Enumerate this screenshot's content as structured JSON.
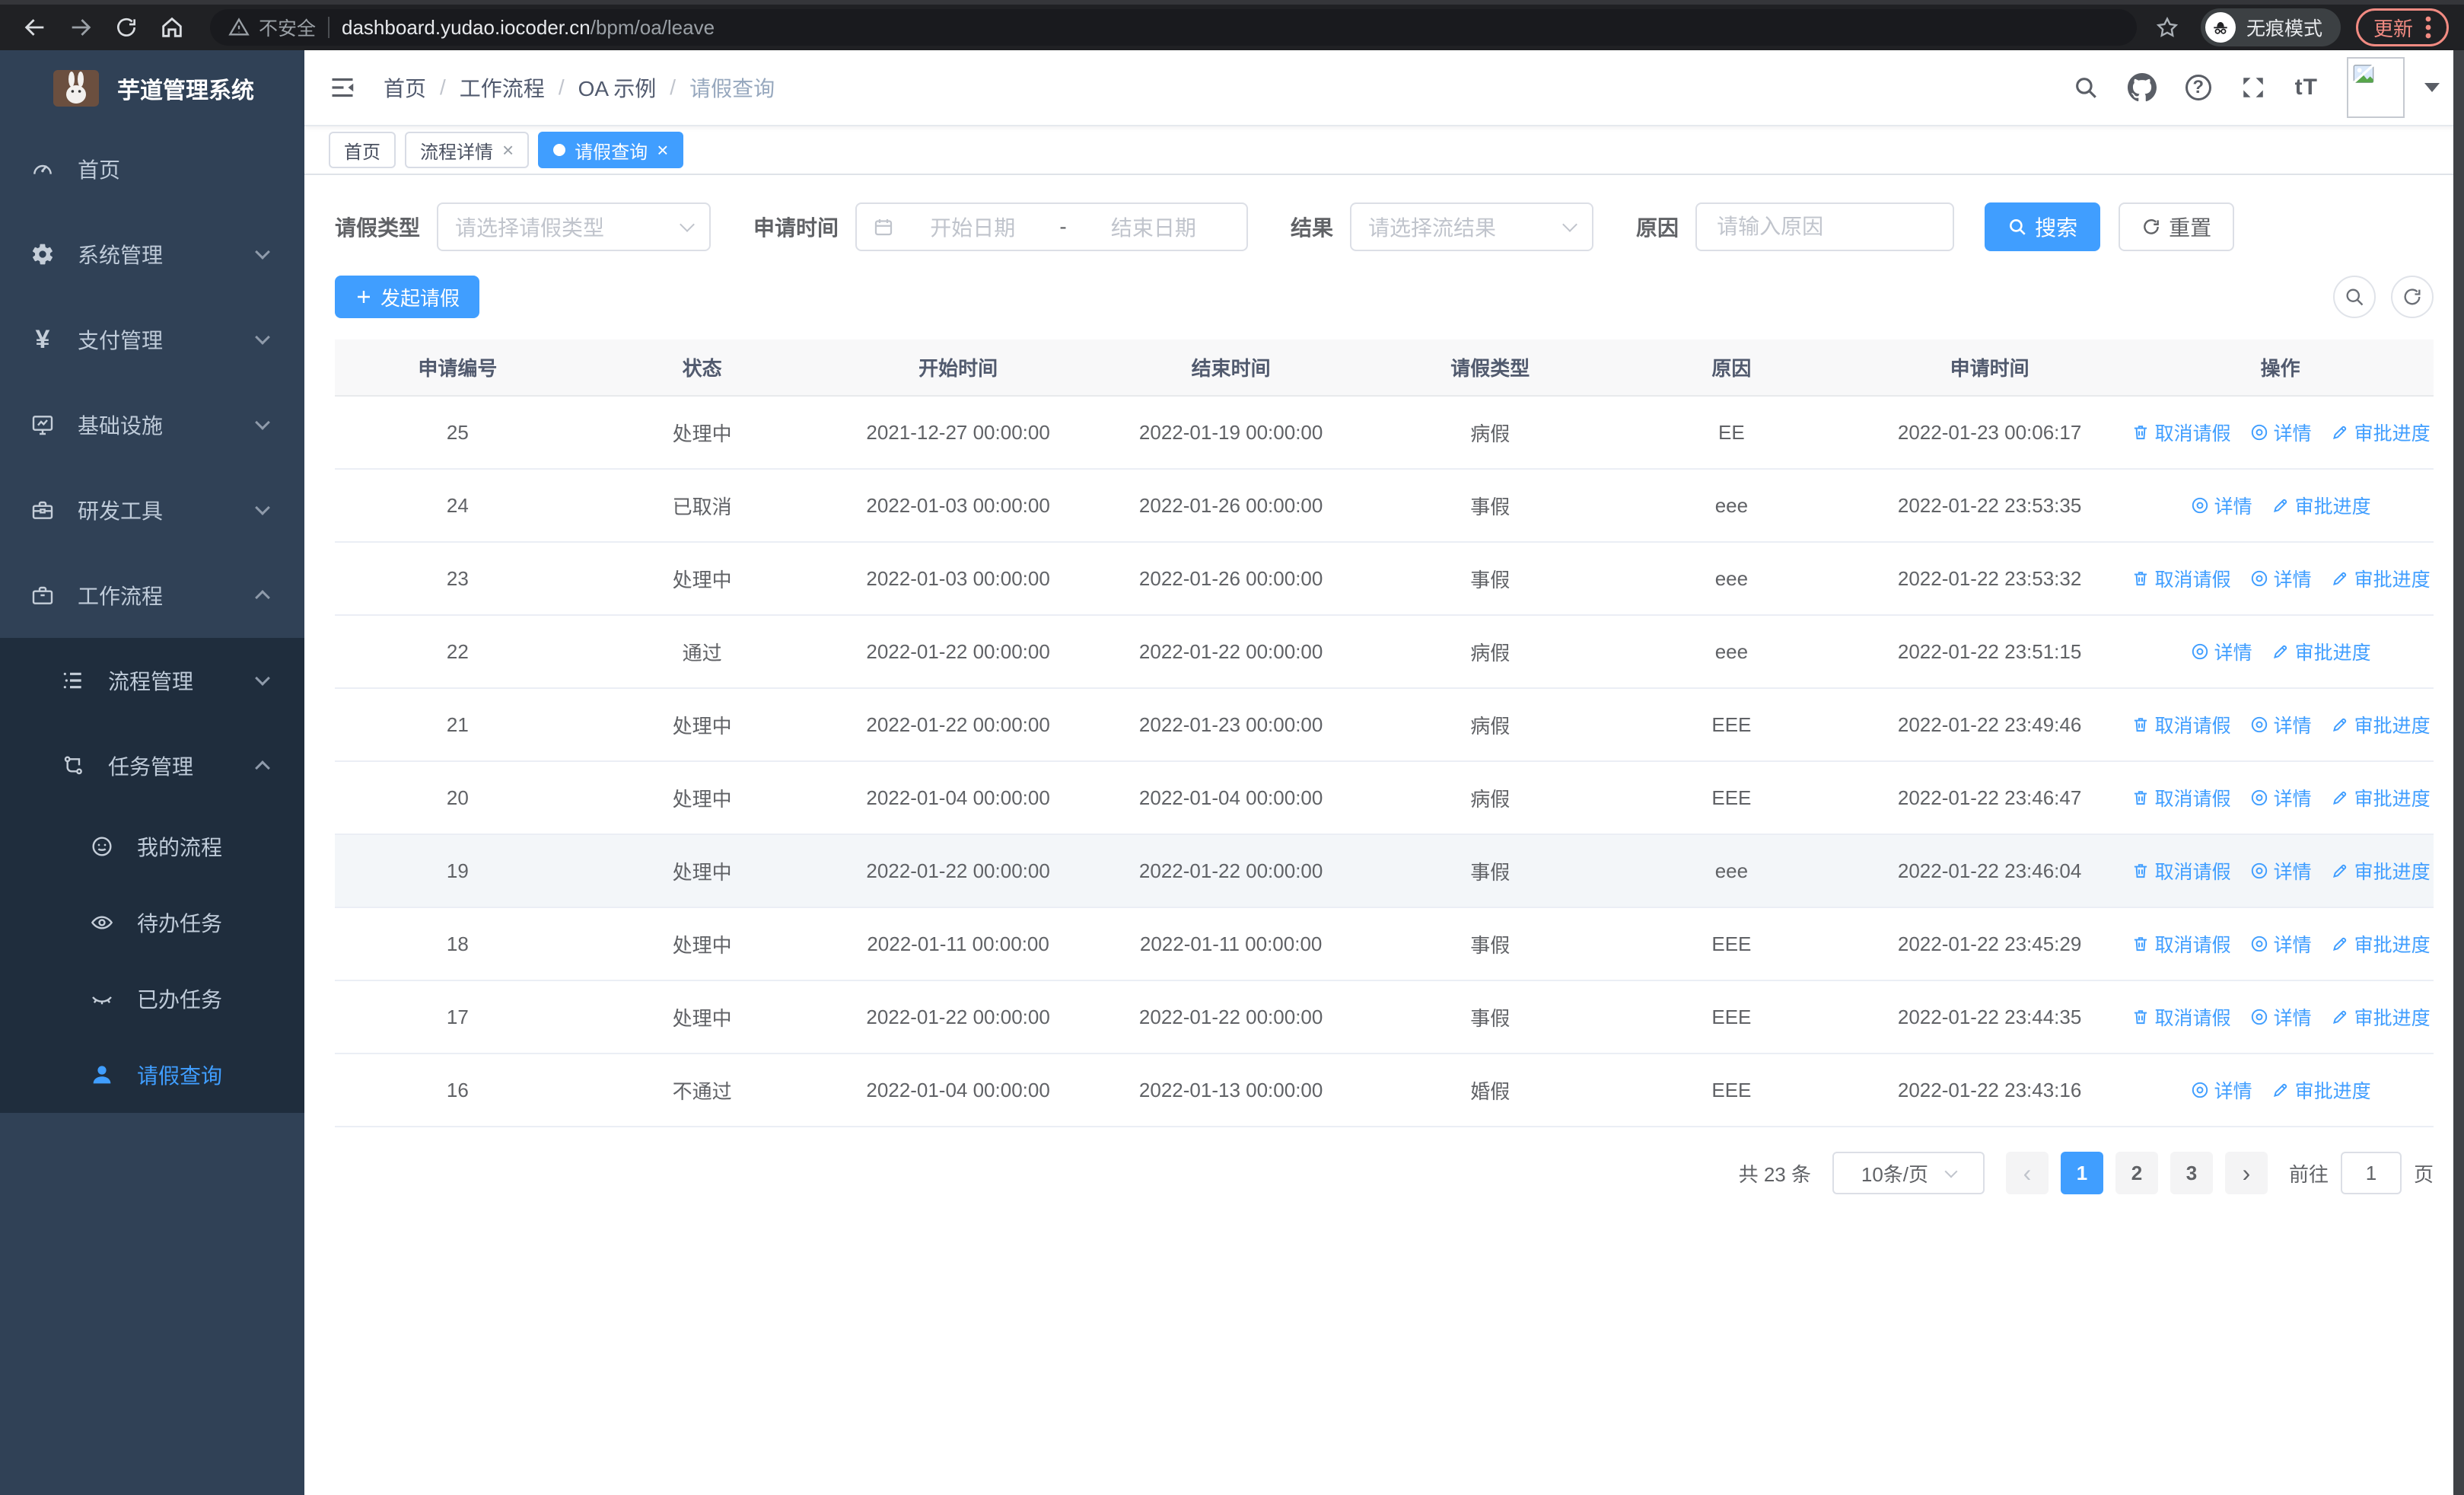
{
  "browser": {
    "security_label": "不安全",
    "url_host": "dashboard.yudao.iocoder.cn",
    "url_path": "/bpm/oa/leave",
    "incognito_label": "无痕模式",
    "update_label": "更新"
  },
  "sidebar": {
    "logo_title": "芋道管理系统",
    "menu": [
      {
        "label": "首页",
        "icon": "dashboard"
      },
      {
        "label": "系统管理",
        "icon": "gear",
        "arrow": "down"
      },
      {
        "label": "支付管理",
        "icon": "yen",
        "arrow": "down"
      },
      {
        "label": "基础设施",
        "icon": "monitor",
        "arrow": "down"
      },
      {
        "label": "研发工具",
        "icon": "toolbox",
        "arrow": "down"
      },
      {
        "label": "工作流程",
        "icon": "briefcase",
        "arrow": "up",
        "children": [
          {
            "label": "流程管理",
            "icon": "list-tree",
            "arrow": "down"
          },
          {
            "label": "任务管理",
            "icon": "flow",
            "arrow": "up",
            "children": [
              {
                "label": "我的流程",
                "icon": "face"
              },
              {
                "label": "待办任务",
                "icon": "eye-open"
              },
              {
                "label": "已办任务",
                "icon": "eye-closed"
              },
              {
                "label": "请假查询",
                "icon": "user",
                "active": true
              }
            ]
          }
        ]
      }
    ]
  },
  "header": {
    "breadcrumb": [
      "首页",
      "工作流程",
      "OA 示例",
      "请假查询"
    ],
    "help_glyph": "?",
    "font_size_label": "tT"
  },
  "tabs": [
    {
      "label": "首页",
      "closable": false,
      "active": false
    },
    {
      "label": "流程详情",
      "closable": true,
      "active": false
    },
    {
      "label": "请假查询",
      "closable": true,
      "active": true
    }
  ],
  "filters": {
    "leave_type_label": "请假类型",
    "leave_type_placeholder": "请选择请假类型",
    "apply_time_label": "申请时间",
    "date_start_placeholder": "开始日期",
    "date_separator": "-",
    "date_end_placeholder": "结束日期",
    "result_label": "结果",
    "result_placeholder": "请选择流结果",
    "reason_label": "原因",
    "reason_placeholder": "请输入原因",
    "search_label": "搜索",
    "reset_label": "重置"
  },
  "toolbar": {
    "create_label": "发起请假"
  },
  "table": {
    "columns": [
      "申请编号",
      "状态",
      "开始时间",
      "结束时间",
      "请假类型",
      "原因",
      "申请时间",
      "操作"
    ],
    "col_widths": [
      "11.7%",
      "11.6%",
      "12.8%",
      "13.2%",
      "11.5%",
      "11.5%",
      "13.1%",
      "14.6%"
    ],
    "actions": {
      "cancel": "取消请假",
      "detail": "详情",
      "progress": "审批进度"
    },
    "rows": [
      {
        "id": "25",
        "status": "处理中",
        "start": "2021-12-27 00:00:00",
        "end": "2022-01-19 00:00:00",
        "type": "病假",
        "reason": "EE",
        "applied": "2022-01-23 00:06:17",
        "cancellable": true
      },
      {
        "id": "24",
        "status": "已取消",
        "start": "2022-01-03 00:00:00",
        "end": "2022-01-26 00:00:00",
        "type": "事假",
        "reason": "eee",
        "applied": "2022-01-22 23:53:35",
        "cancellable": false
      },
      {
        "id": "23",
        "status": "处理中",
        "start": "2022-01-03 00:00:00",
        "end": "2022-01-26 00:00:00",
        "type": "事假",
        "reason": "eee",
        "applied": "2022-01-22 23:53:32",
        "cancellable": true
      },
      {
        "id": "22",
        "status": "通过",
        "start": "2022-01-22 00:00:00",
        "end": "2022-01-22 00:00:00",
        "type": "病假",
        "reason": "eee",
        "applied": "2022-01-22 23:51:15",
        "cancellable": false
      },
      {
        "id": "21",
        "status": "处理中",
        "start": "2022-01-22 00:00:00",
        "end": "2022-01-23 00:00:00",
        "type": "病假",
        "reason": "EEE",
        "applied": "2022-01-22 23:49:46",
        "cancellable": true
      },
      {
        "id": "20",
        "status": "处理中",
        "start": "2022-01-04 00:00:00",
        "end": "2022-01-04 00:00:00",
        "type": "病假",
        "reason": "EEE",
        "applied": "2022-01-22 23:46:47",
        "cancellable": true
      },
      {
        "id": "19",
        "status": "处理中",
        "start": "2022-01-22 00:00:00",
        "end": "2022-01-22 00:00:00",
        "type": "事假",
        "reason": "eee",
        "applied": "2022-01-22 23:46:04",
        "cancellable": true,
        "highlighted": true
      },
      {
        "id": "18",
        "status": "处理中",
        "start": "2022-01-11 00:00:00",
        "end": "2022-01-11 00:00:00",
        "type": "事假",
        "reason": "EEE",
        "applied": "2022-01-22 23:45:29",
        "cancellable": true
      },
      {
        "id": "17",
        "status": "处理中",
        "start": "2022-01-22 00:00:00",
        "end": "2022-01-22 00:00:00",
        "type": "事假",
        "reason": "EEE",
        "applied": "2022-01-22 23:44:35",
        "cancellable": true
      },
      {
        "id": "16",
        "status": "不通过",
        "start": "2022-01-04 00:00:00",
        "end": "2022-01-13 00:00:00",
        "type": "婚假",
        "reason": "EEE",
        "applied": "2022-01-22 23:43:16",
        "cancellable": false
      }
    ]
  },
  "pagination": {
    "total_label": "共 23 条",
    "page_size_label": "10条/页",
    "pages": [
      {
        "label": "1",
        "active": true
      },
      {
        "label": "2",
        "active": false
      },
      {
        "label": "3",
        "active": false
      }
    ],
    "goto_label": "前往",
    "goto_value": "1",
    "page_suffix": "页"
  },
  "colors": {
    "primary": "#409eff",
    "sidebar_bg": "#304156",
    "submenu_bg": "#1f2d3d",
    "update_accent": "#f28b82"
  }
}
